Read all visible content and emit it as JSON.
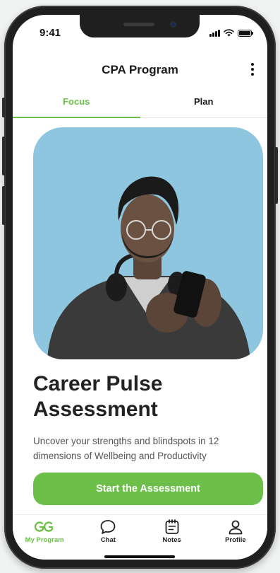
{
  "status_bar": {
    "time": "9:41"
  },
  "header": {
    "title": "CPA Program",
    "menu_icon": "more-vertical-icon"
  },
  "tabs": [
    {
      "label": "Focus",
      "active": true
    },
    {
      "label": "Plan",
      "active": false
    }
  ],
  "hero": {
    "image_desc": "man-with-glasses-looking-at-phone",
    "background_color": "#8ec6df",
    "title_line1": "Career Pulse",
    "title_line2": "Assessment",
    "description": "Uncover your strengths and blindspots in 12 dimensions of Wellbeing and Productivity",
    "cta_label": "Start the Assessment"
  },
  "bottom_nav": [
    {
      "label": "My Program",
      "icon": "program-logo-icon",
      "active": true
    },
    {
      "label": "Chat",
      "icon": "chat-bubble-icon",
      "active": false
    },
    {
      "label": "Notes",
      "icon": "notes-icon",
      "active": false
    },
    {
      "label": "Profile",
      "icon": "user-icon",
      "active": false
    }
  ],
  "colors": {
    "accent": "#6cc04a",
    "text": "#1a1a1a"
  }
}
